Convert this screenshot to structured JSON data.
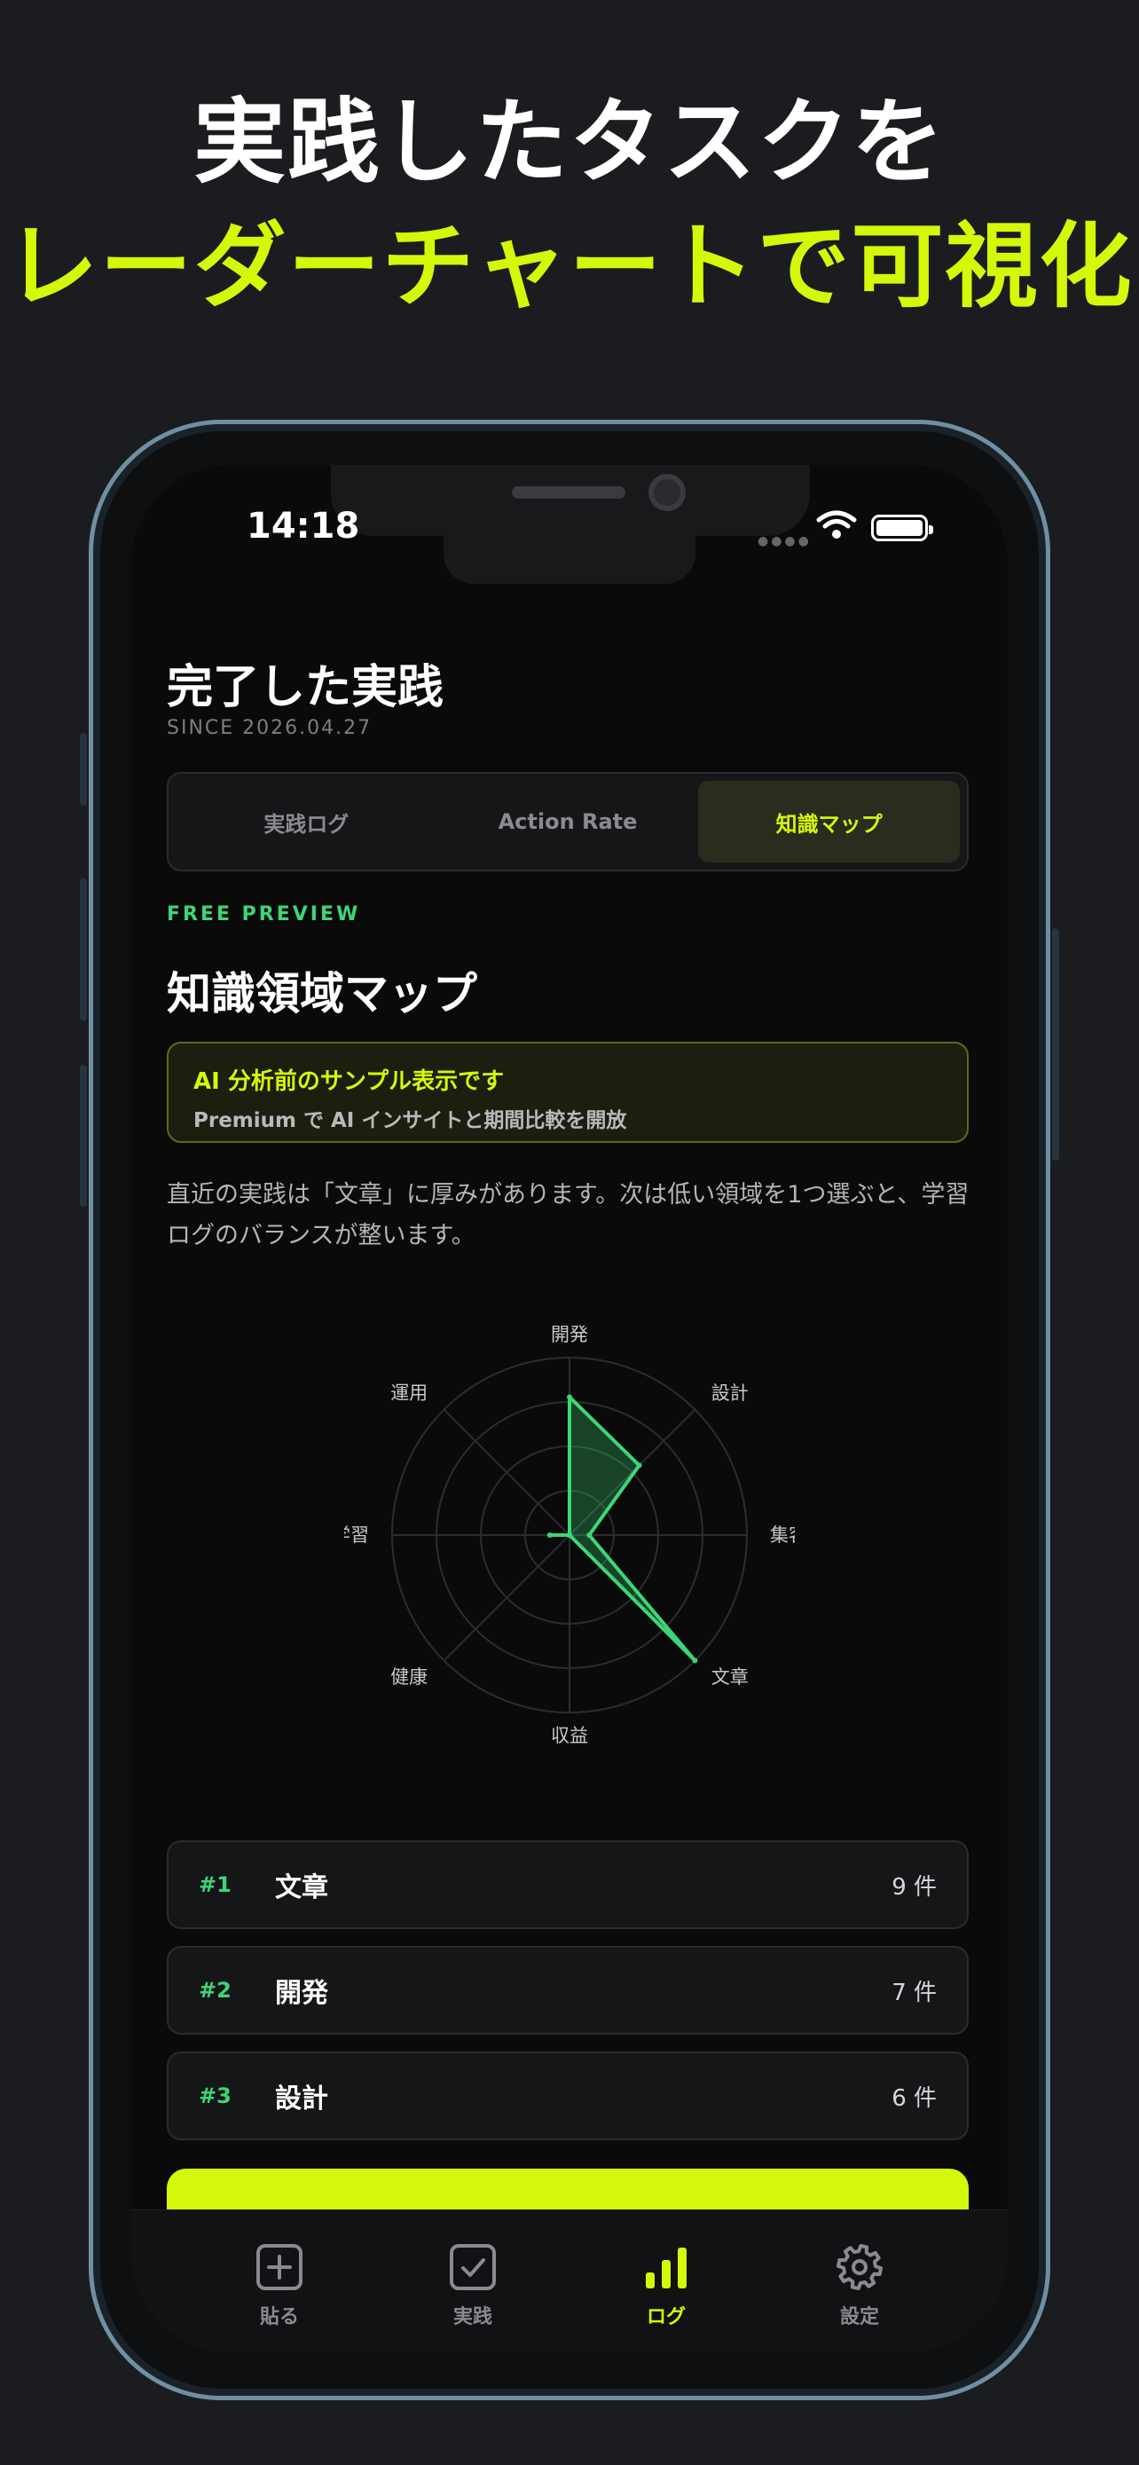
{
  "headline": {
    "line1": "実践したタスクを",
    "line2": "レーダーチャートで可視化"
  },
  "status": {
    "time": "14:18"
  },
  "page": {
    "title": "完了した実践",
    "since": "SINCE 2026.04.27"
  },
  "tabs": [
    {
      "label": "実践ログ",
      "active": false
    },
    {
      "label": "Action Rate",
      "active": false
    },
    {
      "label": "知識マップ",
      "active": true
    }
  ],
  "preview_label": "FREE PREVIEW",
  "section_title": "知識領域マップ",
  "ai_notice": {
    "title": "AI 分析前のサンプル表示です",
    "subtitle": "Premium で AI インサイトと期間比較を開放"
  },
  "description": "直近の実践は「文章」に厚みがあります。次は低い領域を1つ選ぶと、学習ログのバランスが整います。",
  "chart_data": {
    "type": "radar",
    "axes": [
      "開発",
      "設計",
      "集客",
      "文章",
      "収益",
      "健康",
      "学習",
      "運用"
    ],
    "values": [
      7,
      5,
      1,
      9,
      0,
      0,
      1,
      0
    ],
    "max": 9,
    "rings": 4,
    "grid": true,
    "color": "#3cd678"
  },
  "ranking": [
    {
      "rank": "#1",
      "name": "文章",
      "count": "9 件"
    },
    {
      "rank": "#2",
      "name": "開発",
      "count": "7 件"
    },
    {
      "rank": "#3",
      "name": "設計",
      "count": "6 件"
    }
  ],
  "tabbar": [
    {
      "label": "貼る",
      "icon": "plus-square-icon",
      "active": false
    },
    {
      "label": "実践",
      "icon": "check-square-icon",
      "active": false
    },
    {
      "label": "ログ",
      "icon": "bar-chart-icon",
      "active": true
    },
    {
      "label": "設定",
      "icon": "gear-icon",
      "active": false
    }
  ],
  "colors": {
    "accent": "#d4f70a",
    "green": "#3cd678",
    "background": "#0a0a0b"
  }
}
